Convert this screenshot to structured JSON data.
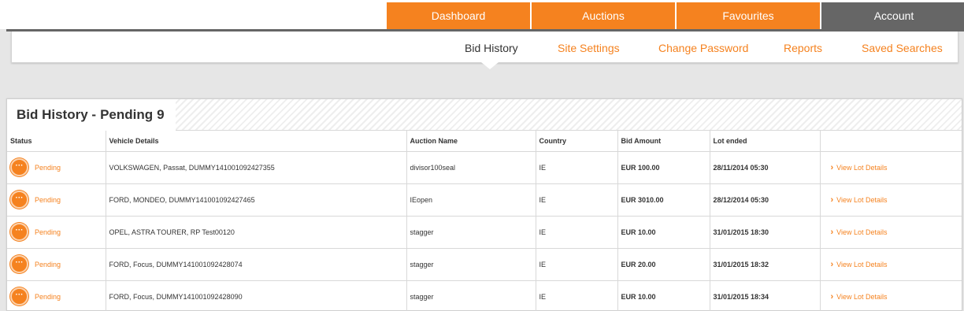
{
  "topnav": {
    "tabs": [
      {
        "label": "Dashboard",
        "name": "tab-dashboard",
        "active": false
      },
      {
        "label": "Auctions",
        "name": "tab-auctions",
        "active": false
      },
      {
        "label": "Favourites",
        "name": "tab-favourites",
        "active": false
      },
      {
        "label": "Account",
        "name": "tab-account",
        "active": true
      }
    ]
  },
  "subnav": {
    "items": [
      {
        "label": "Bid History",
        "active": true
      },
      {
        "label": "Site Settings",
        "active": false
      },
      {
        "label": "Change Password",
        "active": false
      },
      {
        "label": "Reports",
        "active": false
      },
      {
        "label": "Saved Searches",
        "active": false
      }
    ]
  },
  "panel": {
    "title": "Bid History -",
    "status_label": "Pending",
    "count": "9"
  },
  "table": {
    "columns": [
      "Status",
      "Vehicle Details",
      "Auction Name",
      "Country",
      "Bid Amount",
      "Lot ended",
      ""
    ],
    "link_label": "View Lot Details",
    "rows": [
      {
        "status": "Pending",
        "vehicle": "VOLKSWAGEN, Passat, DUMMY141001092427355",
        "auction": "divisor100seal",
        "country": "IE",
        "bid": "EUR 100.00",
        "ended": "28/11/2014 05:30"
      },
      {
        "status": "Pending",
        "vehicle": "FORD, MONDEO, DUMMY141001092427465",
        "auction": "IEopen",
        "country": "IE",
        "bid": "EUR 3010.00",
        "ended": "28/12/2014 05:30"
      },
      {
        "status": "Pending",
        "vehicle": "OPEL, ASTRA TOURER, RP Test00120",
        "auction": "stagger",
        "country": "IE",
        "bid": "EUR 10.00",
        "ended": "31/01/2015 18:30"
      },
      {
        "status": "Pending",
        "vehicle": "FORD, Focus, DUMMY141001092428074",
        "auction": "stagger",
        "country": "IE",
        "bid": "EUR 20.00",
        "ended": "31/01/2015 18:32"
      },
      {
        "status": "Pending",
        "vehicle": "FORD, Focus, DUMMY141001092428090",
        "auction": "stagger",
        "country": "IE",
        "bid": "EUR 10.00",
        "ended": "31/01/2015 18:34"
      }
    ]
  },
  "colors": {
    "accent": "#f5821f",
    "active_tab": "#666666",
    "background": "#e6e6e6"
  }
}
